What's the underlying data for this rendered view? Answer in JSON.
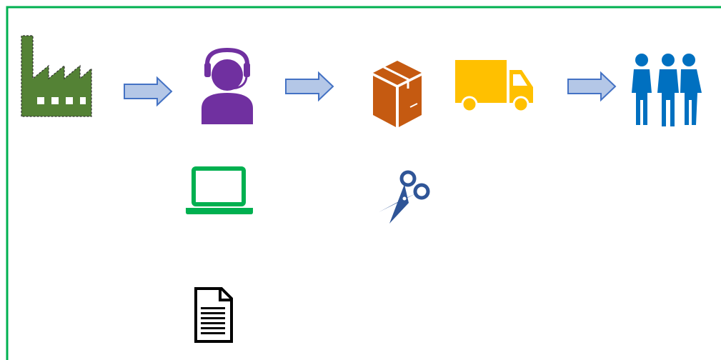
{
  "diagram": {
    "border_color": "#00b050",
    "nodes": [
      {
        "id": "factory",
        "icon": "factory-icon",
        "color": "#538135"
      },
      {
        "id": "agent",
        "icon": "customer-service-agent-icon",
        "color": "#7030a0"
      },
      {
        "id": "package",
        "icon": "package-box-icon",
        "color": "#c55a11"
      },
      {
        "id": "truck",
        "icon": "delivery-truck-icon",
        "color": "#ffc000"
      },
      {
        "id": "customers",
        "icon": "group-of-people-icon",
        "color": "#0070c0"
      },
      {
        "id": "laptop",
        "icon": "laptop-icon",
        "color": "#00b050"
      },
      {
        "id": "scissors",
        "icon": "scissors-icon",
        "color": "#2f5597"
      },
      {
        "id": "document",
        "icon": "document-icon",
        "color": "#000000"
      }
    ],
    "flow": [
      "factory",
      "agent",
      "package",
      "truck",
      "customers"
    ],
    "arrow_color": {
      "fill": "#b4c7e7",
      "stroke": "#4472c4"
    }
  }
}
